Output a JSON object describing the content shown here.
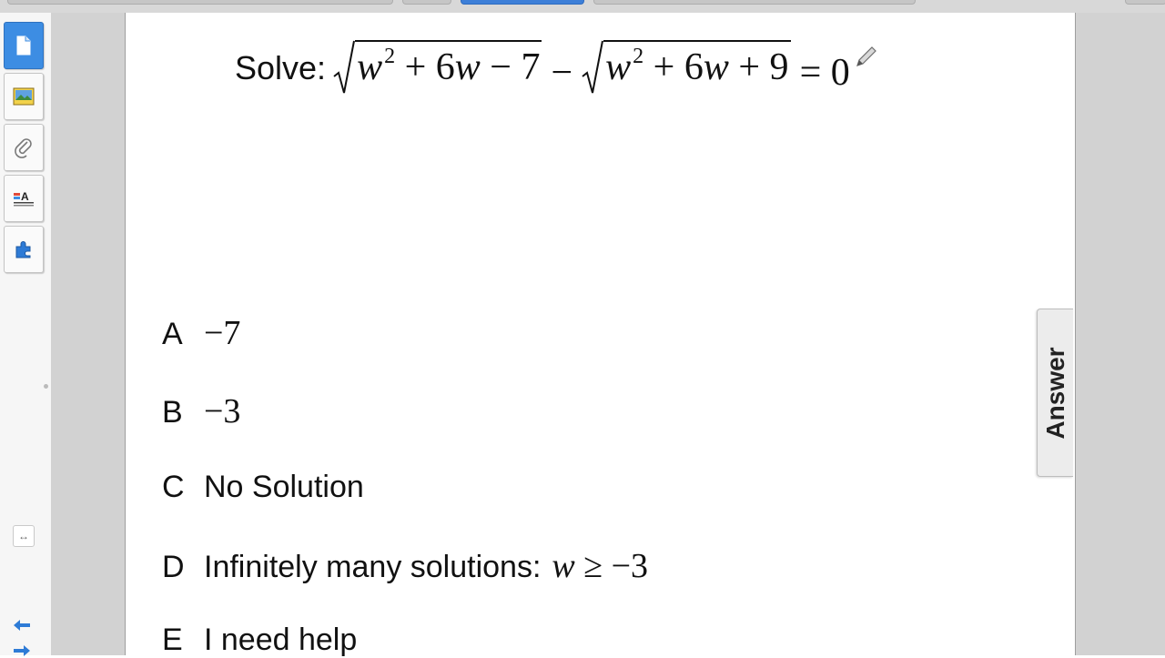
{
  "toolbar": {
    "tools": [
      {
        "name": "page-icon",
        "active": true
      },
      {
        "name": "image-icon",
        "active": false
      },
      {
        "name": "attachment-icon",
        "active": false
      },
      {
        "name": "properties-icon",
        "active": false
      },
      {
        "name": "addons-icon",
        "active": false
      }
    ],
    "collapse_icon": "double-arrow-icon",
    "nav_icons": [
      "arrow-left-icon",
      "arrow-right-icon"
    ]
  },
  "question": {
    "label": "Solve:",
    "radicand1": {
      "var": "w",
      "exp": "2",
      "rest": "+ 6",
      "var2": "w",
      "tail": "− 7"
    },
    "minus": "−",
    "radicand2": {
      "var": "w",
      "exp": "2",
      "rest": "+ 6",
      "var2": "w",
      "tail": "+ 9"
    },
    "equals": "= 0"
  },
  "choices": [
    {
      "letter": "A",
      "text": "−7"
    },
    {
      "letter": "B",
      "text": "−3"
    },
    {
      "letter": "C",
      "text": "No Solution"
    },
    {
      "letter": "D",
      "text": "Infinitely many solutions:",
      "math_var": "w",
      "math_rest": "≥ −3"
    },
    {
      "letter": "E",
      "text": "I need help"
    }
  ],
  "answer_tab": {
    "label": "Answer"
  },
  "colors": {
    "accent": "#3d8de3",
    "gutter": "#d2d2d2"
  }
}
